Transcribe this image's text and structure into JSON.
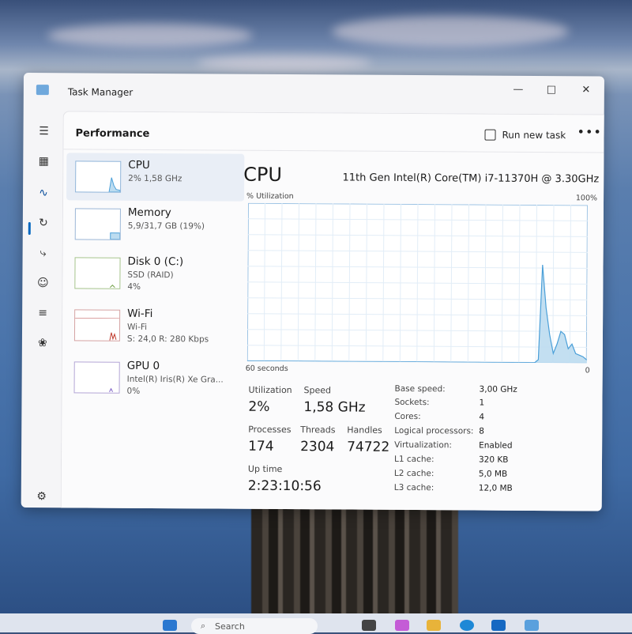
{
  "window": {
    "title": "Task Manager"
  },
  "header": {
    "page_title": "Performance",
    "run_new_task": "Run new task",
    "more": "•••"
  },
  "devices": [
    {
      "name": "CPU",
      "sub1": "2% 1,58 GHz",
      "sub2": ""
    },
    {
      "name": "Memory",
      "sub1": "5,9/31,7 GB (19%)",
      "sub2": ""
    },
    {
      "name": "Disk 0 (C:)",
      "sub1": "SSD (RAID)",
      "sub2": "4%"
    },
    {
      "name": "Wi-Fi",
      "sub1": "Wi-Fi",
      "sub2": "S: 24,0 R: 280 Kbps"
    },
    {
      "name": "GPU 0",
      "sub1": "Intel(R) Iris(R) Xe Gra...",
      "sub2": "0%"
    }
  ],
  "detail": {
    "title": "CPU",
    "model": "11th Gen Intel(R) Core(TM) i7-11370H @ 3.30GHz",
    "util_label": "% Utilization",
    "util_max": "100%",
    "axis_left": "60 seconds",
    "axis_right": "0",
    "stats": {
      "utilization_label": "Utilization",
      "utilization": "2%",
      "speed_label": "Speed",
      "speed": "1,58 GHz",
      "processes_label": "Processes",
      "processes": "174",
      "threads_label": "Threads",
      "threads": "2304",
      "handles_label": "Handles",
      "handles": "74722",
      "uptime_label": "Up time",
      "uptime": "2:23:10:56"
    },
    "specs": [
      {
        "k": "Base speed:",
        "v": "3,00 GHz"
      },
      {
        "k": "Sockets:",
        "v": "1"
      },
      {
        "k": "Cores:",
        "v": "4"
      },
      {
        "k": "Logical processors:",
        "v": "8"
      },
      {
        "k": "Virtualization:",
        "v": "Enabled"
      },
      {
        "k": "L1 cache:",
        "v": "320 KB"
      },
      {
        "k": "L2 cache:",
        "v": "5,0 MB"
      },
      {
        "k": "L3 cache:",
        "v": "12,0 MB"
      }
    ]
  },
  "cpu_history": [
    0,
    0,
    0,
    0,
    0,
    0,
    0,
    0,
    0,
    0,
    0,
    0,
    0,
    0,
    0,
    0,
    0,
    0,
    0,
    0,
    0,
    0,
    0,
    0,
    0,
    0,
    0,
    0,
    0,
    0,
    0,
    0,
    0,
    0,
    0,
    0,
    0,
    0,
    0,
    0,
    0,
    0,
    0,
    0,
    0,
    0,
    0,
    0,
    0,
    0,
    0,
    0,
    0,
    0,
    0,
    0,
    0,
    0,
    0,
    0,
    0,
    0,
    0,
    0,
    0,
    0,
    0,
    0,
    0,
    0,
    0,
    0,
    0,
    0,
    0,
    0,
    0,
    0,
    2,
    62,
    35,
    18,
    6,
    12,
    20,
    18,
    9,
    12,
    6,
    5,
    4,
    2
  ],
  "taskbar": {
    "search": "Search"
  },
  "colors": {
    "accent": "#0067c0",
    "graph_line": "#4a9fd8",
    "graph_fill": "#bcdcf0"
  }
}
